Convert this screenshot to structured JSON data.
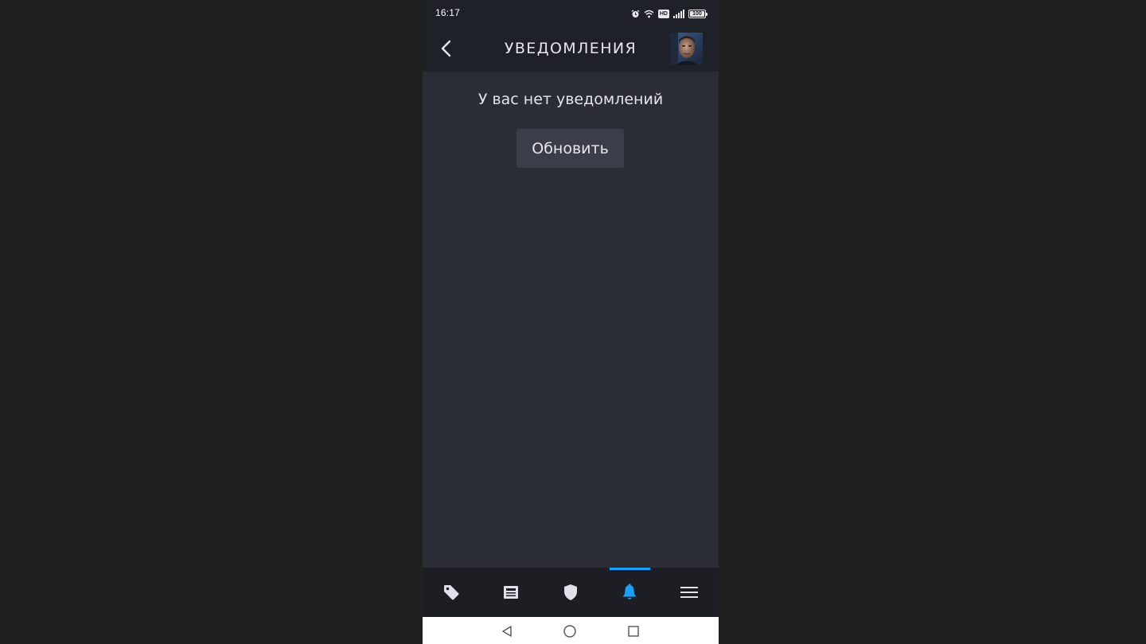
{
  "status_bar": {
    "time": "16:17",
    "icons": [
      "alarm-icon",
      "wifi-icon",
      "hd-icon",
      "signal-icon",
      "battery-icon"
    ],
    "hd_label": "HD",
    "battery_level": "100"
  },
  "header": {
    "title": "УВЕДОМЛЕНИЯ",
    "back_icon": "chevron-left-icon",
    "avatar": "user-avatar"
  },
  "content": {
    "empty_message": "У вас нет уведомлений",
    "refresh_label": "Обновить"
  },
  "bottom_nav": {
    "items": [
      {
        "name": "store",
        "icon": "tag-icon",
        "active": false
      },
      {
        "name": "news",
        "icon": "news-icon",
        "active": false
      },
      {
        "name": "guard",
        "icon": "shield-icon",
        "active": false
      },
      {
        "name": "notifications",
        "icon": "bell-icon",
        "active": true
      },
      {
        "name": "menu",
        "icon": "hamburger-menu-icon",
        "active": false
      }
    ]
  },
  "system_nav": {
    "buttons": [
      "back-triangle-icon",
      "home-circle-icon",
      "recents-square-icon"
    ]
  },
  "colors": {
    "background": "#202020",
    "header_bg": "#1f2128",
    "content_bg": "#2a2d35",
    "button_bg": "#3b3e48",
    "accent": "#1a9fff",
    "text": "#e6e8ec"
  }
}
